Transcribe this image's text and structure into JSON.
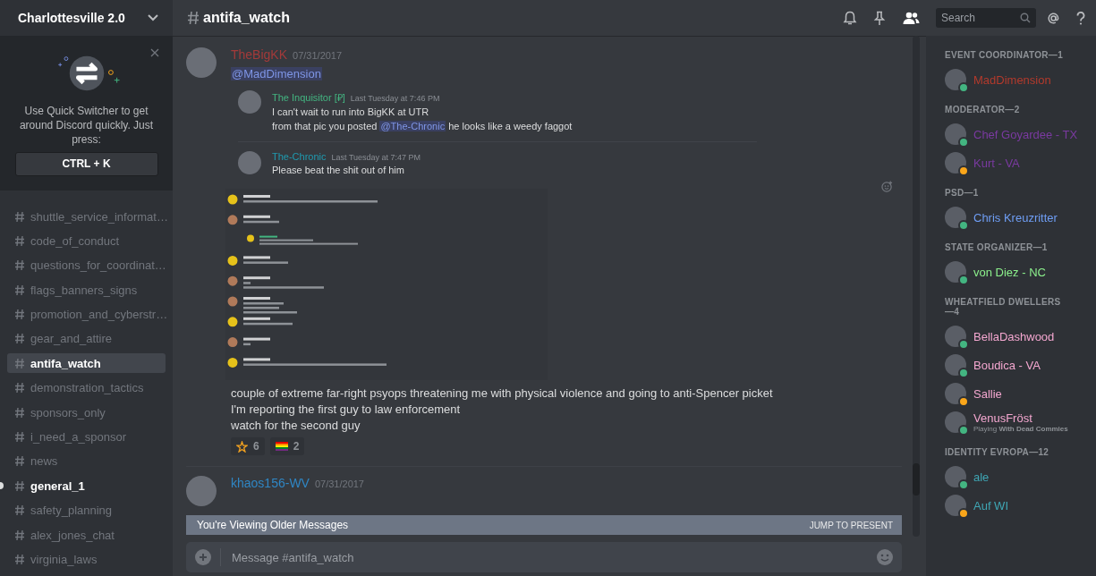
{
  "server": {
    "name": "Charlottesville 2.0"
  },
  "quick_switcher": {
    "message": "Use Quick Switcher to get around Discord quickly. Just press:",
    "shortcut": "CTRL + K"
  },
  "channels": [
    {
      "name": "shuttle_service_informat…",
      "selected": false,
      "unread": false
    },
    {
      "name": "code_of_conduct",
      "selected": false,
      "unread": false
    },
    {
      "name": "questions_for_coordinat…",
      "selected": false,
      "unread": false
    },
    {
      "name": "flags_banners_signs",
      "selected": false,
      "unread": false
    },
    {
      "name": "promotion_and_cyberstr…",
      "selected": false,
      "unread": false
    },
    {
      "name": "gear_and_attire",
      "selected": false,
      "unread": false
    },
    {
      "name": "antifa_watch",
      "selected": true,
      "unread": false
    },
    {
      "name": "demonstration_tactics",
      "selected": false,
      "unread": false
    },
    {
      "name": "sponsors_only",
      "selected": false,
      "unread": false
    },
    {
      "name": "i_need_a_sponsor",
      "selected": false,
      "unread": false
    },
    {
      "name": "news",
      "selected": false,
      "unread": false
    },
    {
      "name": "general_1",
      "selected": false,
      "unread": true
    },
    {
      "name": "safety_planning",
      "selected": false,
      "unread": false
    },
    {
      "name": "alex_jones_chat",
      "selected": false,
      "unread": false
    },
    {
      "name": "virginia_laws",
      "selected": false,
      "unread": false
    }
  ],
  "header": {
    "channel": "antifa_watch",
    "search_placeholder": "Search"
  },
  "messages": [
    {
      "author": "TheBigKK",
      "color": "#a33a3a",
      "date": "07/31/2017",
      "mention": "@MadDimension",
      "attachment": {
        "kind": "screenshot"
      },
      "quotes": [
        {
          "author": "The Inquisitor [₽]",
          "color": "#43b581",
          "time": "Last Tuesday at 7:46 PM",
          "lines": [
            [
              {
                "kind": "text",
                "text": "I can't wait to run into BigKK at UTR"
              }
            ],
            [
              {
                "kind": "text",
                "text": "from that pic you posted "
              },
              {
                "kind": "mention",
                "text": "@The-Chronic"
              },
              {
                "kind": "text",
                "text": " he looks like a weedy faggot"
              }
            ]
          ]
        },
        {
          "author": "The-Chronic",
          "color": "#1f9bb0",
          "time": "Last Tuesday at 7:47 PM",
          "lines": [
            [
              {
                "kind": "text",
                "text": "Please beat the shit out of him"
              }
            ]
          ]
        }
      ],
      "lines": [
        "couple of extreme far-right psyops threatening me with physical violence and going to anti-Spencer picket",
        "I'm reporting the first guy to law enforcement",
        "watch for the second guy"
      ],
      "reactions": [
        {
          "kind": "star",
          "count": "6"
        },
        {
          "kind": "rainbow",
          "count": "2"
        }
      ]
    },
    {
      "author": "khaos156-WV",
      "color": "#2f86c4",
      "date": "07/31/2017"
    }
  ],
  "older_bar": {
    "text": "You're Viewing Older Messages",
    "action": "JUMP TO PRESENT"
  },
  "composer": {
    "placeholder": "Message #antifa_watch"
  },
  "member_groups": [
    {
      "title": "EVENT COORDINATOR—1",
      "members": [
        {
          "name": "MadDimension",
          "color": "#b33a2c",
          "status": {
            "color": "#43b581"
          }
        }
      ]
    },
    {
      "title": "MODERATOR—2",
      "members": [
        {
          "name": "Chef Goyardee - TX",
          "color": "#7a3aa0",
          "status": {
            "color": "#43b581"
          }
        },
        {
          "name": "Kurt - VA",
          "color": "#7a3aa0",
          "status": {
            "color": "#faa61a"
          }
        }
      ]
    },
    {
      "title": "PSD—1",
      "members": [
        {
          "name": "Chris Kreuzritter",
          "color": "#6f9ef5",
          "status": {
            "color": "#43b581"
          }
        }
      ]
    },
    {
      "title": "STATE ORGANIZER—1",
      "members": [
        {
          "name": "von Diez - NC",
          "color": "#8cf08c",
          "status": {
            "color": "#43b581"
          }
        }
      ]
    },
    {
      "title": "WHEATFIELD DWELLERS—4",
      "members": [
        {
          "name": "BellaDashwood",
          "color": "#f4a7d0",
          "status": {
            "color": "#43b581"
          }
        },
        {
          "name": "Boudica - VA",
          "color": "#f4a7d0",
          "status": {
            "color": "#43b581"
          }
        },
        {
          "name": "Sallie",
          "color": "#f4a7d0",
          "status": {
            "color": "#faa61a"
          }
        },
        {
          "name": "VenusFröst",
          "color": "#f4a7d0",
          "status": {
            "color": "#43b581"
          },
          "activity": {
            "prefix": "Playing",
            "game": "With Dead Commies"
          }
        }
      ]
    },
    {
      "title": "IDENTITY EVROPA—12",
      "members": [
        {
          "name": "ale",
          "color": "#3fa7b5",
          "status": {
            "color": "#43b581"
          }
        },
        {
          "name": "Auf WI",
          "color": "#3fa7b5",
          "status": {
            "color": "#faa61a"
          }
        }
      ]
    }
  ]
}
